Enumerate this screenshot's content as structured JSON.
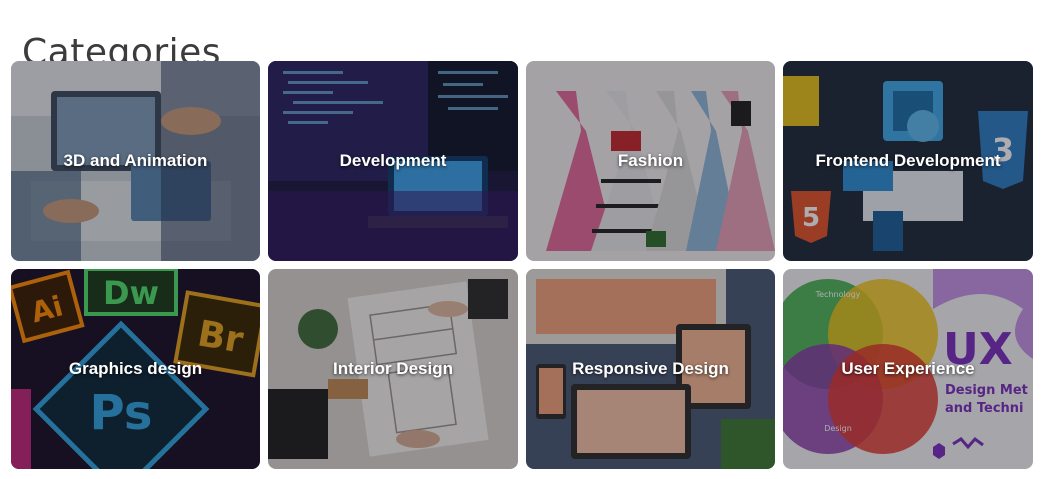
{
  "page": {
    "title": "Categories"
  },
  "categories": [
    {
      "label": "3D and Animation"
    },
    {
      "label": "Development"
    },
    {
      "label": "Fashion"
    },
    {
      "label": "Frontend Development"
    },
    {
      "label": "Graphics design"
    },
    {
      "label": "Interior Design"
    },
    {
      "label": "Responsive Design"
    },
    {
      "label": "User Experience"
    }
  ],
  "icons": {
    "html5": "5",
    "css3": "3",
    "ai": "Ai",
    "dw": "Dw",
    "br": "Br",
    "ps": "Ps",
    "ux": "UX",
    "ux_subtitle_1": "Design Met",
    "ux_subtitle_2": "and Techni",
    "venn_technology": "Technology",
    "venn_design": "Design"
  }
}
